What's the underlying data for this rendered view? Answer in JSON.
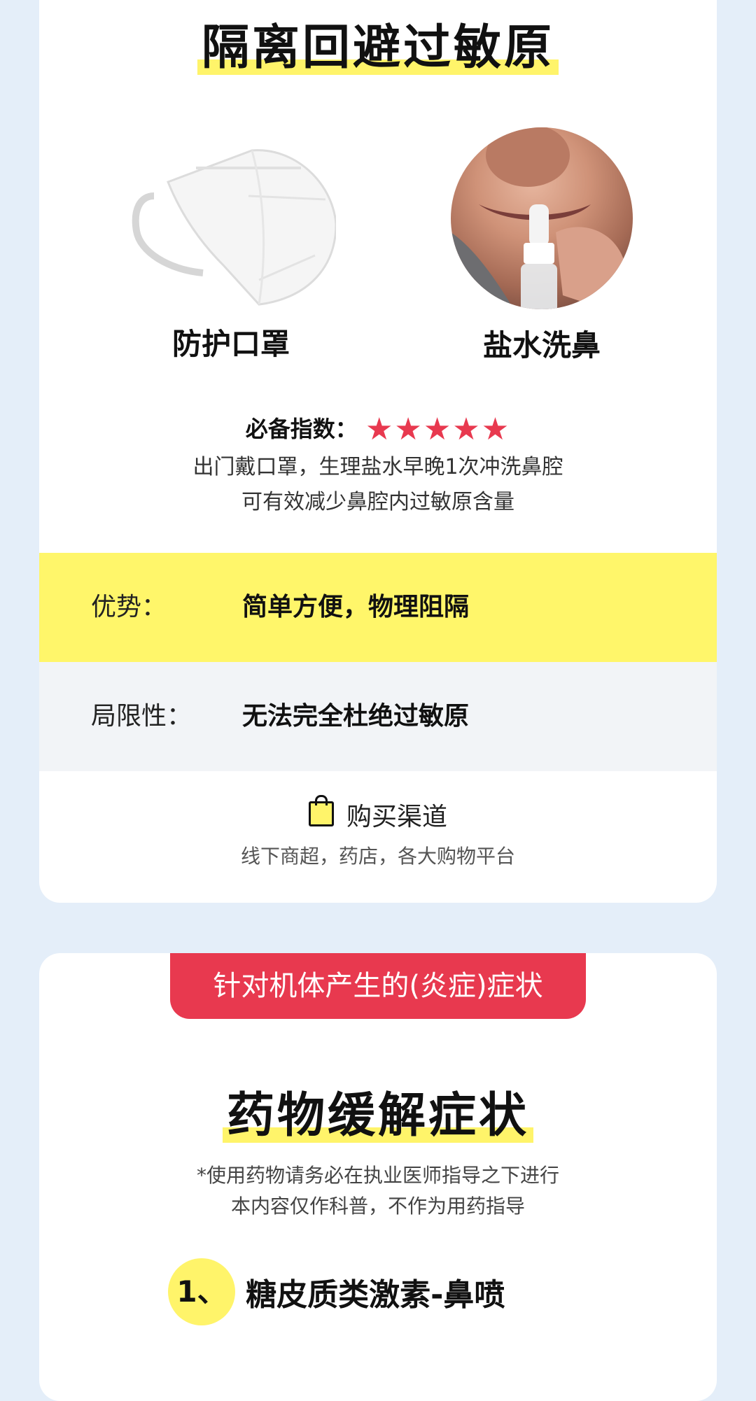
{
  "section1": {
    "title": "隔离回避过敏原",
    "products": [
      {
        "label": "防护口罩",
        "icon": "face-mask-image"
      },
      {
        "label": "盐水洗鼻",
        "icon": "nasal-spray-photo"
      }
    ],
    "rating": {
      "label": "必备指数：",
      "stars": "★★★★★",
      "score": 5
    },
    "description": [
      "出门戴口罩，生理盐水早晚1次冲洗鼻腔",
      "可有效减少鼻腔内过敏原含量"
    ],
    "advantage": {
      "key": "优势：",
      "value": "简单方便，物理阻隔"
    },
    "limitation": {
      "key": "局限性：",
      "value": "无法完全杜绝过敏原"
    },
    "purchase": {
      "title": "购买渠道",
      "channels": "线下商超，药店，各大购物平台"
    }
  },
  "section2": {
    "tag": "针对机体产生的(炎症)症状",
    "title": "药物缓解症状",
    "notes": [
      "*使用药物请务必在执业医师指导之下进行",
      "本内容仅作科普，不作为用药指导"
    ],
    "item": {
      "number": "1、",
      "name": "糖皮质类激素-鼻喷"
    }
  },
  "colors": {
    "accent_red": "#e8394f",
    "highlight_yellow": "#fff46a",
    "background": "#e4eef9"
  }
}
